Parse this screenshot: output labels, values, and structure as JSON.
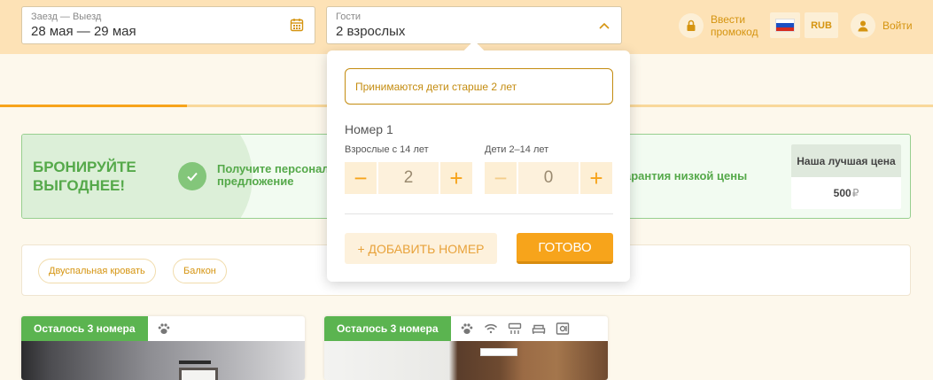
{
  "header": {
    "dates": {
      "label": "Заезд — Выезд",
      "value": "28 мая — 29 мая",
      "icon": "calendar-icon"
    },
    "guests": {
      "label": "Гости",
      "value": "2 взрослых",
      "icon": "chevron-up-icon"
    },
    "promo": {
      "label": "Ввести промокод",
      "icon": "lock-icon"
    },
    "language": {
      "flag": "russia-flag-icon"
    },
    "currency": "RUB",
    "login": {
      "label": "Войти",
      "icon": "user-icon"
    }
  },
  "progress": {
    "fraction": 0.2
  },
  "banner": {
    "headline": "БРОНИРУЙТЕ ВЫГОДНЕЕ!",
    "offer": "Получите персонал предложение",
    "guarantee": "арантия низкой цены",
    "best_price_title": "Наша лучшая цена",
    "best_price_value": "500",
    "best_price_currency": "₽"
  },
  "filters": {
    "chips": [
      "Двуспальная кровать",
      "Балкон"
    ]
  },
  "cards": [
    {
      "tag": "Осталось 3 номера",
      "amenities": [
        "pet-icon"
      ]
    },
    {
      "tag": "Осталось 3 номера",
      "amenities": [
        "pet-icon",
        "wifi-icon",
        "air-conditioner-icon",
        "bed-icon",
        "safe-icon"
      ]
    }
  ],
  "guest_picker": {
    "notice": "Принимаются дети старше 2 лет",
    "room_title": "Номер 1",
    "adults": {
      "label": "Взрослые с 14 лет",
      "value": "2",
      "minus": "−",
      "plus": "+"
    },
    "children": {
      "label": "Дети 2–14 лет",
      "value": "0",
      "minus": "−",
      "plus": "+"
    },
    "add_room": "+ ДОБАВИТЬ НОМЕР",
    "done": "ГОТОВО"
  },
  "colors": {
    "accent": "#f7a41b",
    "green": "#5bb450",
    "header_bg": "#fde2b6"
  }
}
